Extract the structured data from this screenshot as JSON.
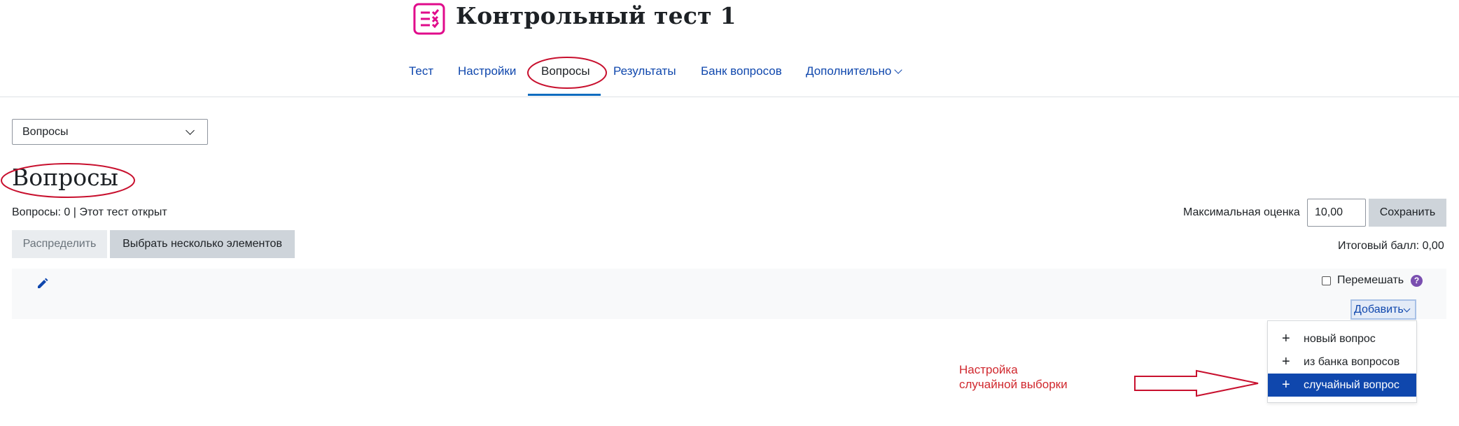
{
  "header": {
    "title": "Контрольный тест 1",
    "icon": "quiz-icon",
    "icon_color": "#e00b8b"
  },
  "tabs": [
    {
      "label": "Тест"
    },
    {
      "label": "Настройки"
    },
    {
      "label": "Вопросы",
      "active": true
    },
    {
      "label": "Результаты"
    },
    {
      "label": "Банк вопросов"
    },
    {
      "label": "Дополнительно"
    }
  ],
  "page_select": {
    "value": "Вопросы"
  },
  "page_title": "Вопросы",
  "info_line": "Вопросы: 0 | Этот тест открыт",
  "buttons": {
    "repaginate": "Распределить",
    "select_multiple": "Выбрать несколько элементов",
    "save": "Сохранить"
  },
  "grade": {
    "max_label": "Максимальная оценка",
    "max_value": "10,00",
    "total": "Итоговый балл: 0,00"
  },
  "section": {
    "shuffle_label": "Перемешать",
    "shuffle_checked": false,
    "add_label": "Добавить"
  },
  "add_menu": [
    {
      "label": "новый вопрос"
    },
    {
      "label": "из банка вопросов"
    },
    {
      "label": "случайный вопрос",
      "highlighted": true
    }
  ],
  "annotation": {
    "text": "Настройка\nслучайной выборки",
    "color": "#d0282e"
  },
  "colors": {
    "link": "#0f47ad",
    "accent": "#0f6cbf",
    "highlight_bg": "#0f47ad",
    "annotation_red": "#d0282e"
  }
}
